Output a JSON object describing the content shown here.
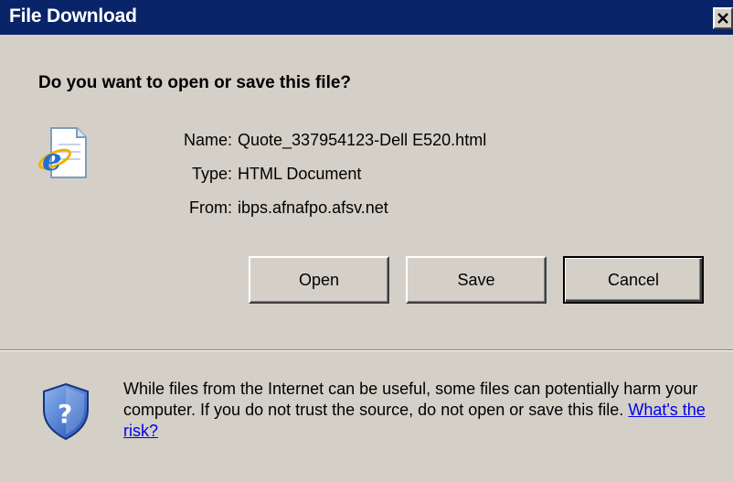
{
  "window": {
    "title": "File Download"
  },
  "dialog": {
    "question": "Do you want to open or save this file?",
    "file": {
      "name_label": "Name:",
      "name_value": "Quote_337954123-Dell E520.html",
      "type_label": "Type:",
      "type_value": "HTML Document",
      "from_label": "From:",
      "from_value": "ibps.afnafpo.afsv.net",
      "icon": "ie-document-icon"
    },
    "buttons": {
      "open": "Open",
      "save": "Save",
      "cancel": "Cancel"
    },
    "warning": {
      "icon": "shield-question-icon",
      "text": "While files from the Internet can be useful, some files can potentially harm your computer. If you do not trust the source, do not open or save this file.",
      "link": "What's the risk?"
    }
  },
  "colors": {
    "titlebar": "#0a246a",
    "window_bg": "#d4d0c8",
    "link": "#0000ee"
  }
}
